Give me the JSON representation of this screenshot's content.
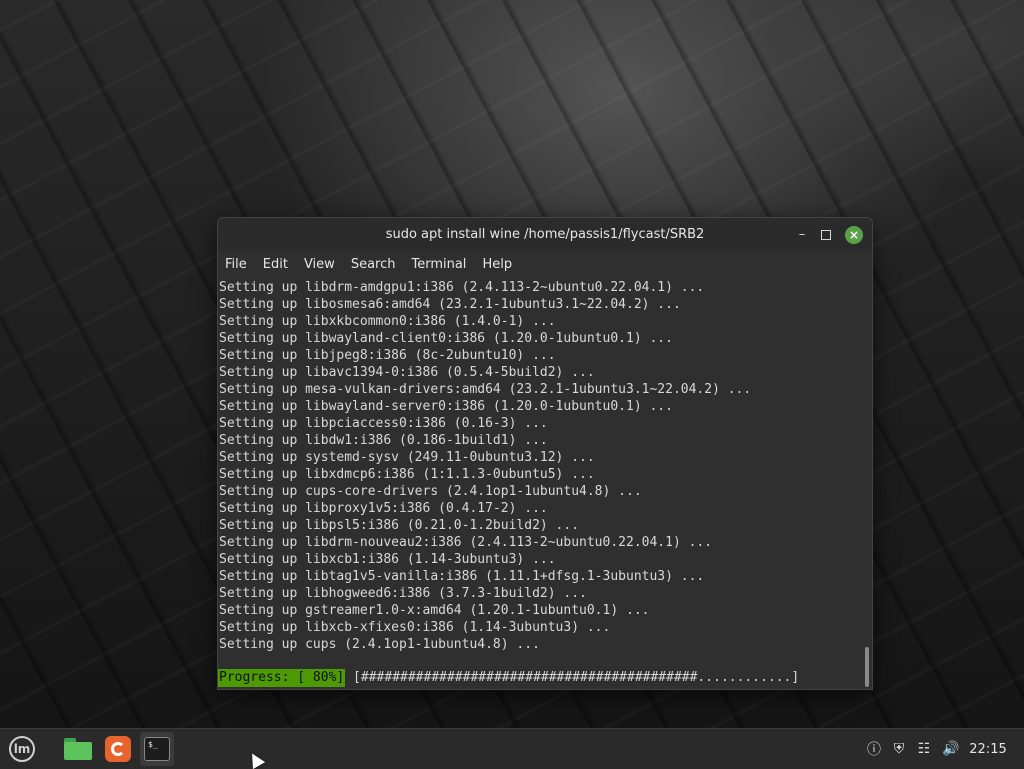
{
  "window": {
    "title": "sudo apt install wine /home/passis1/flycast/SRB2",
    "controls": {
      "minimize": "–",
      "close": "×"
    }
  },
  "menu": [
    "File",
    "Edit",
    "View",
    "Search",
    "Terminal",
    "Help"
  ],
  "terminal": {
    "lines": [
      "Setting up libdrm-amdgpu1:i386 (2.4.113-2~ubuntu0.22.04.1) ...",
      "Setting up libosmesa6:amd64 (23.2.1-1ubuntu3.1~22.04.2) ...",
      "Setting up libxkbcommon0:i386 (1.4.0-1) ...",
      "Setting up libwayland-client0:i386 (1.20.0-1ubuntu0.1) ...",
      "Setting up libjpeg8:i386 (8c-2ubuntu10) ...",
      "Setting up libavc1394-0:i386 (0.5.4-5build2) ...",
      "Setting up mesa-vulkan-drivers:amd64 (23.2.1-1ubuntu3.1~22.04.2) ...",
      "Setting up libwayland-server0:i386 (1.20.0-1ubuntu0.1) ...",
      "Setting up libpciaccess0:i386 (0.16-3) ...",
      "Setting up libdw1:i386 (0.186-1build1) ...",
      "Setting up systemd-sysv (249.11-0ubuntu3.12) ...",
      "Setting up libxdmcp6:i386 (1:1.1.3-0ubuntu5) ...",
      "Setting up cups-core-drivers (2.4.1op1-1ubuntu4.8) ...",
      "Setting up libproxy1v5:i386 (0.4.17-2) ...",
      "Setting up libpsl5:i386 (0.21.0-1.2build2) ...",
      "Setting up libdrm-nouveau2:i386 (2.4.113-2~ubuntu0.22.04.1) ...",
      "Setting up libxcb1:i386 (1.14-3ubuntu3) ...",
      "Setting up libtag1v5-vanilla:i386 (1.11.1+dfsg.1-3ubuntu3) ...",
      "Setting up libhogweed6:i386 (3.7.3-1build2) ...",
      "Setting up gstreamer1.0-x:amd64 (1.20.1-1ubuntu0.1) ...",
      "Setting up libxcb-xfixes0:i386 (1.14-3ubuntu3) ...",
      "Setting up cups (2.4.1op1-1ubuntu4.8) ..."
    ],
    "progress_label": "Progress: [ 80%]",
    "progress_bar": " [###########################################............]",
    "progress_percent": 80
  },
  "taskbar": {
    "menu_logo": "lm",
    "terminal_icon_text": "$_",
    "clock": "22:15",
    "tray_icons": [
      "update-manager-icon",
      "shield-icon",
      "network-icon",
      "volume-icon"
    ]
  },
  "colors": {
    "progress_highlight": "#4e9a06",
    "close_button": "#5aa14a",
    "firefox": "#e8642c",
    "folder": "#5cc35c"
  }
}
